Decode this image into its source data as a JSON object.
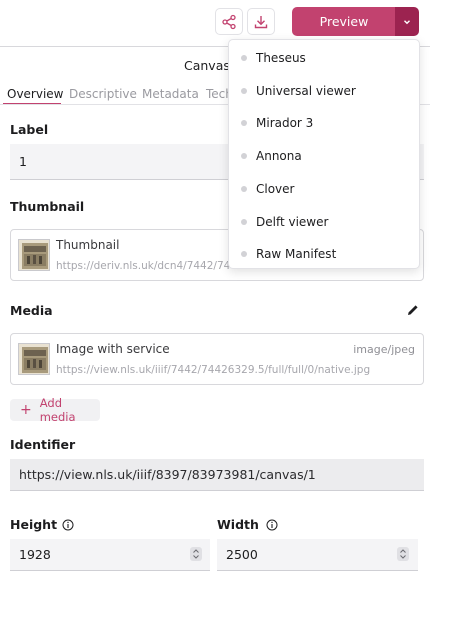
{
  "toolbar": {
    "share_icon": "share-icon",
    "download_icon": "download-icon",
    "preview_label": "Preview",
    "accent_color": "#c2426f",
    "accent_dark": "#9c2350"
  },
  "canvas_title": "Canvas",
  "tabs": [
    {
      "label": "Overview",
      "active": true
    },
    {
      "label": "Descriptive",
      "active": false
    },
    {
      "label": "Metadata",
      "active": false
    },
    {
      "label": "Tech",
      "active": false
    }
  ],
  "label_section": {
    "title": "Label",
    "value": "1"
  },
  "thumbnail_section": {
    "title": "Thumbnail",
    "item": {
      "title": "Thumbnail",
      "url": "https://deriv.nls.uk/dcn4/7442/7442"
    }
  },
  "media_section": {
    "title": "Media",
    "item": {
      "title": "Image with service",
      "type": "image/jpeg",
      "url": "https://view.nls.uk/iiif/7442/74426329.5/full/full/0/native.jpg"
    },
    "add_label": "Add media"
  },
  "identifier_section": {
    "title": "Identifier",
    "value": "https://view.nls.uk/iiif/8397/83973981/canvas/1"
  },
  "height_section": {
    "title": "Height",
    "value": "1928"
  },
  "width_section": {
    "title": "Width",
    "value": "2500"
  },
  "preview_menu": [
    "Theseus",
    "Universal viewer",
    "Mirador 3",
    "Annona",
    "Clover",
    "Delft viewer",
    "Raw Manifest"
  ]
}
